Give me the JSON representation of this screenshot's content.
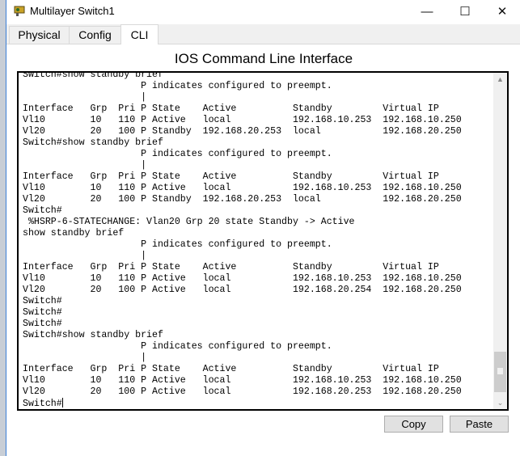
{
  "window": {
    "title": "Multilayer Switch1",
    "icon": "switch-icon",
    "minimize": "—",
    "maximize": "☐",
    "close": "✕"
  },
  "tabs": [
    {
      "label": "Physical"
    },
    {
      "label": "Config"
    },
    {
      "label": "CLI",
      "active": true
    }
  ],
  "heading": "IOS Command Line Interface",
  "terminal": {
    "lines": [
      "Switch#show standby brief",
      "                     P indicates configured to preempt.",
      "                     |",
      "Interface   Grp  Pri P State    Active          Standby         Virtual IP",
      "Vl10        10   110 P Active   local           192.168.10.253  192.168.10.250",
      "Vl20        20   100 P Standby  192.168.20.253  local           192.168.20.250",
      "Switch#show standby brief",
      "                     P indicates configured to preempt.",
      "                     |",
      "Interface   Grp  Pri P State    Active          Standby         Virtual IP",
      "Vl10        10   110 P Active   local           192.168.10.253  192.168.10.250",
      "Vl20        20   100 P Standby  192.168.20.253  local           192.168.20.250",
      "Switch#",
      " %HSRP-6-STATECHANGE: Vlan20 Grp 20 state Standby -> Active",
      "show standby brief",
      "                     P indicates configured to preempt.",
      "                     |",
      "Interface   Grp  Pri P State    Active          Standby         Virtual IP",
      "Vl10        10   110 P Active   local           192.168.10.253  192.168.10.250",
      "Vl20        20   100 P Active   local           192.168.20.254  192.168.20.250",
      "Switch#",
      "Switch#",
      "Switch#",
      "Switch#show standby brief",
      "                     P indicates configured to preempt.",
      "                     |",
      "Interface   Grp  Pri P State    Active          Standby         Virtual IP",
      "Vl10        10   110 P Active   local           192.168.10.253  192.168.10.250",
      "Vl20        20   100 P Active   local           192.168.20.253  192.168.20.250"
    ],
    "prompt": "Switch#"
  },
  "buttons": {
    "copy": "Copy",
    "paste": "Paste"
  }
}
